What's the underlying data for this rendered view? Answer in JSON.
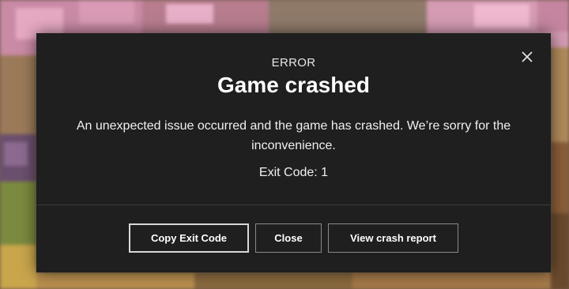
{
  "dialog": {
    "label": "ERROR",
    "title": "Game crashed",
    "message": "An unexpected issue occurred and the game has crashed. We’re sorry for the inconvenience.",
    "exit_code": "Exit Code: 1",
    "close_icon": "close-icon"
  },
  "buttons": {
    "copy": "Copy Exit Code",
    "close": "Close",
    "report": "View crash report"
  },
  "colors": {
    "dialog_bg": "#1f1f1f",
    "text": "#ffffff",
    "button_border": "#8a8a8a",
    "focused_button_border": "#d8d8d8"
  }
}
